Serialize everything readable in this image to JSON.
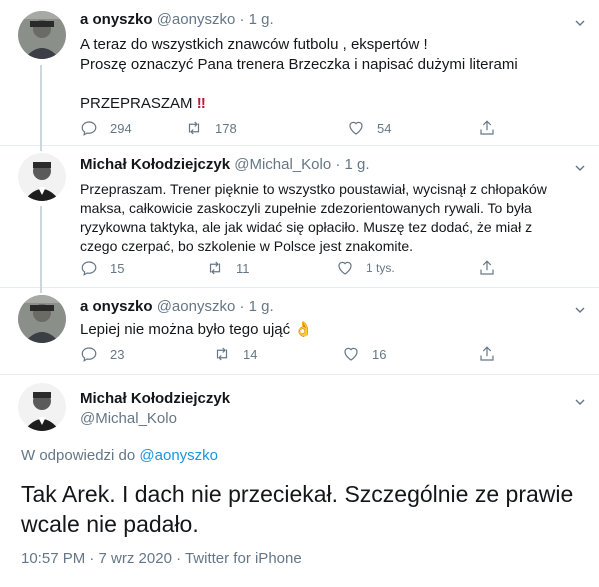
{
  "tweets": [
    {
      "name": "a onyszko",
      "handle": "@aonyszko",
      "separator": "·",
      "time": "1 g.",
      "lines": [
        "A teraz do wszystkich znawców futbolu , ekspertów !",
        "Proszę oznaczyć Pana trenera Brzeczka i napisać dużymi literami",
        "",
        "PRZEPRASZAM"
      ],
      "emoji": "‼",
      "replies": "294",
      "retweets": "178",
      "likes": "54"
    },
    {
      "name": "Michał Kołodziejczyk",
      "handle": "@Michal_Kolo",
      "separator": "·",
      "time": "1 g.",
      "lines": [
        "Przepraszam. Trener pięknie to wszystko poustawiał, wycisnął z chłopaków",
        "maksa, całkowicie zaskoczyli zupełnie zdezorientowanych rywali. To była",
        "ryzykowna taktyka, ale jak widać się opłaciło. Muszę tez dodać, że miał z",
        "czego czerpać, bo szkolenie w Polsce jest znakomite."
      ],
      "replies": "15",
      "retweets": "11",
      "likes": "1 tys."
    },
    {
      "name": "a onyszko",
      "handle": "@aonyszko",
      "separator": "·",
      "time": "1 g.",
      "lines": [
        "Lepiej nie można było tego ująć"
      ],
      "emoji": "👌",
      "replies": "23",
      "retweets": "14",
      "likes": "16"
    }
  ],
  "main": {
    "name": "Michał Kołodziejczyk",
    "handle": "@Michal_Kolo",
    "reply_prefix": "W odpowiedzi do",
    "reply_handle": "@aonyszko",
    "line1": "Tak Arek. I dach nie przeciekał. Szczególnie ze prawie",
    "line2": "wcale nie padało.",
    "timestamp": "10:57 PM · 7 wrz 2020 · Twitter for iPhone"
  },
  "colors": {
    "link": "#1b95e0",
    "gray": "#657786",
    "line": "#ccd6dd"
  }
}
